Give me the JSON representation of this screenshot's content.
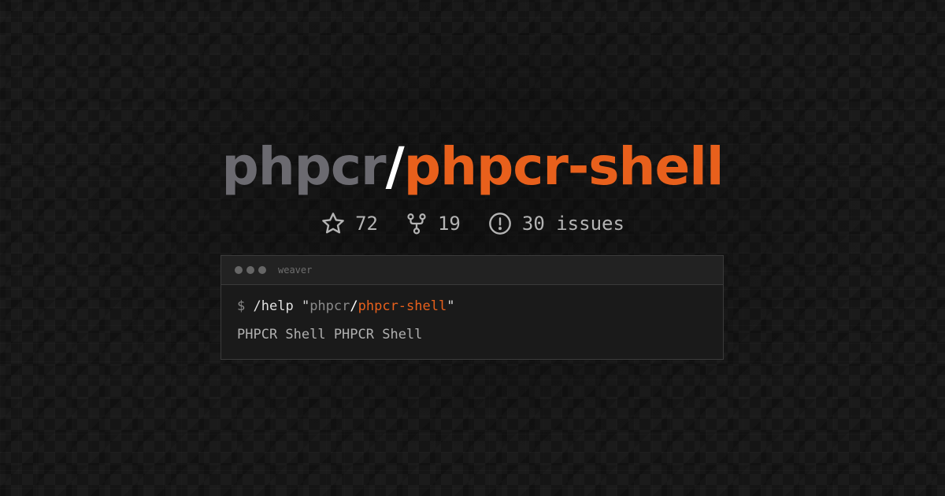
{
  "repo": {
    "owner": "phpcr",
    "separator": "/",
    "name": "phpcr-shell"
  },
  "stats": {
    "stars": "72",
    "forks": "19",
    "issues": "30 issues"
  },
  "terminal": {
    "title": "weaver",
    "prompt": "$",
    "command": "/help",
    "quote_open": "\"",
    "arg_owner": "phpcr",
    "arg_separator": "/",
    "arg_repo": "phpcr-shell",
    "quote_close": "\"",
    "output": "PHPCR Shell PHPCR Shell"
  },
  "colors": {
    "background": "#151515",
    "owner": "#6b6a70",
    "accent": "#e8601c",
    "text": "#b4b4b4"
  },
  "icons": [
    "star-icon",
    "fork-icon",
    "issue-icon"
  ]
}
